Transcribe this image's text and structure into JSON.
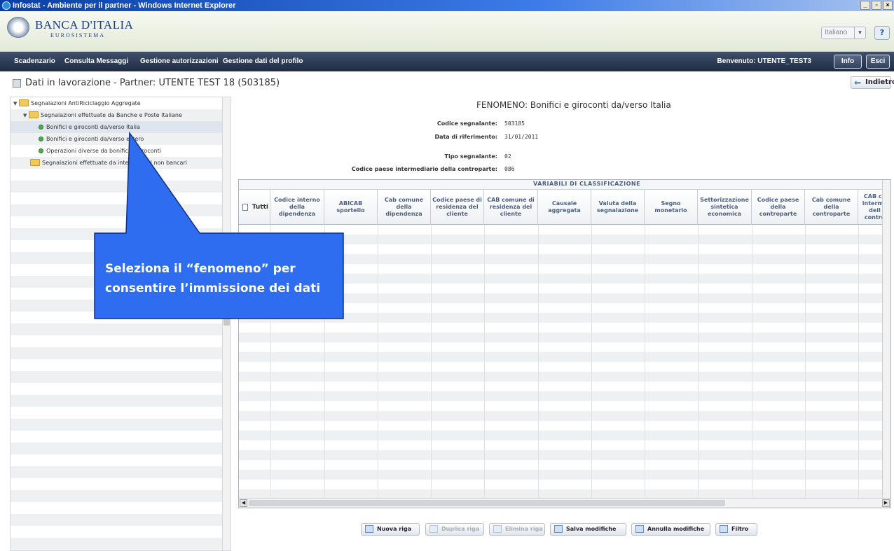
{
  "window": {
    "title": "Infostat - Ambiente per il partner - Windows Internet Explorer"
  },
  "header": {
    "brand": "BANCA D'ITALIA",
    "brand_sub": "EUROSISTEMA",
    "language": "Italiano"
  },
  "nav": {
    "items": [
      "Scadenzario",
      "Consulta Messaggi",
      "Gestione autorizzazioni",
      "Gestione dati del profilo"
    ],
    "welcome": "Benvenuto:  UTENTE_TEST3",
    "info_label": "Info",
    "exit_label": "Esci"
  },
  "page": {
    "title": "Dati in lavorazione - Partner: UTENTE TEST 18 (503185)",
    "back_label": "Indietro"
  },
  "tree": {
    "nodes": [
      {
        "label": "Segnalazioni AntiRiciclaggio Aggregate",
        "type": "folder",
        "expanded": true
      },
      {
        "label": "Segnalazioni effettuate da  Banche e Poste Italiane",
        "type": "folder",
        "expanded": true
      },
      {
        "label": "Bonifici e giroconti da/verso Italia",
        "type": "leaf",
        "selected": true
      },
      {
        "label": "Bonifici e giroconti da/verso estero",
        "type": "leaf"
      },
      {
        "label": "Operazioni diverse da bonifici e giroconti",
        "type": "leaf"
      },
      {
        "label": "Segnalazioni effettuate da intermediari non bancari",
        "type": "folder",
        "expanded": false
      }
    ]
  },
  "detail": {
    "fenomeno": "FENOMENO: Bonifici e giroconti da/verso Italia",
    "fields": [
      {
        "label": "Codice segnalante:",
        "value": "503185"
      },
      {
        "label": "Data di riferimento:",
        "value": "31/01/2011"
      },
      {
        "label": "Tipo segnalante:",
        "value": "02"
      },
      {
        "label": "Codice paese intermediario della controparte:",
        "value": "086"
      }
    ]
  },
  "grid": {
    "group_label": "VARIABILI DI CLASSIFICAZIONE",
    "select_all_label": "Tutti",
    "columns": [
      "Codice interno della dipendenza",
      "ABICAB sportello",
      "Cab comune della dipendenza",
      "Codice paese di residenza del cliente",
      "CAB comune di residenza del cliente",
      "Causale aggregata",
      "Valuta della segnalazione",
      "Segno monetario",
      "Settorizzazione sintetica economica",
      "Codice paese della controparte",
      "Cab comune della controparte",
      "CAB co interme dell contro"
    ]
  },
  "toolbar": {
    "buttons": [
      {
        "label": "Nuova riga",
        "enabled": true
      },
      {
        "label": "Duplica riga",
        "enabled": false
      },
      {
        "label": "Elimina riga",
        "enabled": false
      },
      {
        "label": "Salva modifiche",
        "enabled": true
      },
      {
        "label": "Annulla modifiche",
        "enabled": true
      },
      {
        "label": "Filtro",
        "enabled": true
      }
    ]
  },
  "callout": {
    "text": "Seleziona il “fenomeno” per consentire l’immissione dei dati",
    "color": "#2e6cf0"
  }
}
